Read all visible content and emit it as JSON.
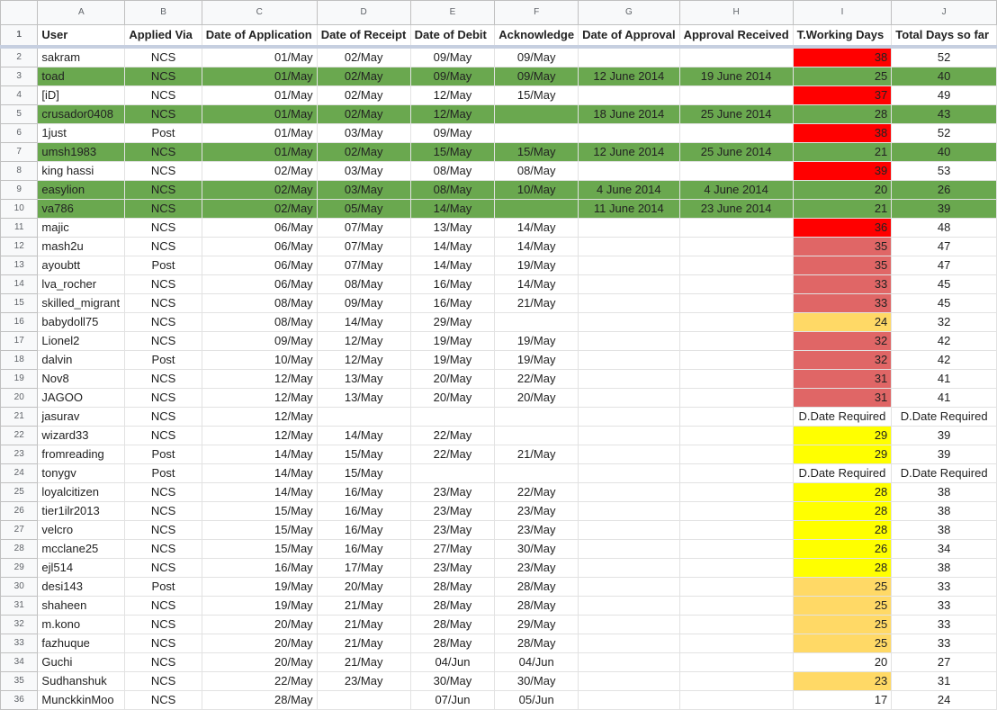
{
  "columns": [
    "A",
    "B",
    "C",
    "D",
    "E",
    "F",
    "G",
    "H",
    "I",
    "J"
  ],
  "headers": [
    "User",
    "Applied Via",
    "Date of Application",
    "Date of Receipt",
    "Date of Debit",
    "Acknowledge",
    "Date of Approval",
    "Approval Received",
    "T.Working Days",
    "Total Days so far"
  ],
  "colors": {
    "approved_row": "#6aa84f",
    "red": "#ff0000",
    "light_red": "#e06666",
    "orange": "#ffd966",
    "yellow": "#ffff00"
  },
  "rows": [
    {
      "n": "2",
      "c": [
        "sakram",
        "NCS",
        "01/May",
        "02/May",
        "09/May",
        "09/May",
        "",
        "",
        "38",
        "52"
      ],
      "g": false,
      "h": "bred"
    },
    {
      "n": "3",
      "c": [
        "toad",
        "NCS",
        "01/May",
        "02/May",
        "09/May",
        "09/May",
        "12 June 2014",
        "19 June 2014",
        "25",
        "40"
      ],
      "g": true,
      "h": ""
    },
    {
      "n": "4",
      "c": [
        "[iD]",
        "NCS",
        "01/May",
        "02/May",
        "12/May",
        "15/May",
        "",
        "",
        "37",
        "49"
      ],
      "g": false,
      "h": "bred"
    },
    {
      "n": "5",
      "c": [
        "crusador0408",
        "NCS",
        "01/May",
        "02/May",
        "12/May",
        "",
        "18 June 2014",
        "25 June 2014",
        "28",
        "43"
      ],
      "g": true,
      "h": ""
    },
    {
      "n": "6",
      "c": [
        "1just",
        "Post",
        "01/May",
        "03/May",
        "09/May",
        "",
        "",
        "",
        "38",
        "52"
      ],
      "g": false,
      "h": "bred"
    },
    {
      "n": "7",
      "c": [
        "umsh1983",
        "NCS",
        "01/May",
        "02/May",
        "15/May",
        "15/May",
        "12 June 2014",
        "25 June 2014",
        "21",
        "40"
      ],
      "g": true,
      "h": ""
    },
    {
      "n": "8",
      "c": [
        "king hassi",
        "NCS",
        "02/May",
        "03/May",
        "08/May",
        "08/May",
        "",
        "",
        "39",
        "53"
      ],
      "g": false,
      "h": "bred"
    },
    {
      "n": "9",
      "c": [
        "easylion",
        "NCS",
        "02/May",
        "03/May",
        "08/May",
        "10/May",
        "4 June 2014",
        "4 June 2014",
        "20",
        "26"
      ],
      "g": true,
      "h": ""
    },
    {
      "n": "10",
      "c": [
        "va786",
        "NCS",
        "02/May",
        "05/May",
        "14/May",
        "",
        "11 June 2014",
        "23 June 2014",
        "21",
        "39"
      ],
      "g": true,
      "h": ""
    },
    {
      "n": "11",
      "c": [
        "majic",
        "NCS",
        "06/May",
        "07/May",
        "13/May",
        "14/May",
        "",
        "",
        "36",
        "48"
      ],
      "g": false,
      "h": "bred"
    },
    {
      "n": "12",
      "c": [
        "mash2u",
        "NCS",
        "06/May",
        "07/May",
        "14/May",
        "14/May",
        "",
        "",
        "35",
        "47"
      ],
      "g": false,
      "h": "blred"
    },
    {
      "n": "13",
      "c": [
        "ayoubtt",
        "Post",
        "06/May",
        "07/May",
        "14/May",
        "19/May",
        "",
        "",
        "35",
        "47"
      ],
      "g": false,
      "h": "blred"
    },
    {
      "n": "14",
      "c": [
        "lva_rocher",
        "NCS",
        "06/May",
        "08/May",
        "16/May",
        "14/May",
        "",
        "",
        "33",
        "45"
      ],
      "g": false,
      "h": "blred"
    },
    {
      "n": "15",
      "c": [
        "skilled_migrant",
        "NCS",
        "08/May",
        "09/May",
        "16/May",
        "21/May",
        "",
        "",
        "33",
        "45"
      ],
      "g": false,
      "h": "blred"
    },
    {
      "n": "16",
      "c": [
        "babydoll75",
        "NCS",
        "08/May",
        "14/May",
        "29/May",
        "",
        "",
        "",
        "24",
        "32"
      ],
      "g": false,
      "h": "borange"
    },
    {
      "n": "17",
      "c": [
        "Lionel2",
        "NCS",
        "09/May",
        "12/May",
        "19/May",
        "19/May",
        "",
        "",
        "32",
        "42"
      ],
      "g": false,
      "h": "blred"
    },
    {
      "n": "18",
      "c": [
        "dalvin",
        "Post",
        "10/May",
        "12/May",
        "19/May",
        "19/May",
        "",
        "",
        "32",
        "42"
      ],
      "g": false,
      "h": "blred"
    },
    {
      "n": "19",
      "c": [
        "Nov8",
        "NCS",
        "12/May",
        "13/May",
        "20/May",
        "22/May",
        "",
        "",
        "31",
        "41"
      ],
      "g": false,
      "h": "blred"
    },
    {
      "n": "20",
      "c": [
        "JAGOO",
        "NCS",
        "12/May",
        "13/May",
        "20/May",
        "20/May",
        "",
        "",
        "31",
        "41"
      ],
      "g": false,
      "h": "blred"
    },
    {
      "n": "21",
      "c": [
        "jasurav",
        "NCS",
        "12/May",
        "",
        "",
        "",
        "",
        "",
        "D.Date Required",
        "D.Date Required"
      ],
      "g": false,
      "h": "",
      "t": true
    },
    {
      "n": "22",
      "c": [
        "wizard33",
        "NCS",
        "12/May",
        "14/May",
        "22/May",
        "",
        "",
        "",
        "29",
        "39"
      ],
      "g": false,
      "h": "byellow"
    },
    {
      "n": "23",
      "c": [
        "fromreading",
        "Post",
        "14/May",
        "15/May",
        "22/May",
        "21/May",
        "",
        "",
        "29",
        "39"
      ],
      "g": false,
      "h": "byellow"
    },
    {
      "n": "24",
      "c": [
        "tonygv",
        "Post",
        "14/May",
        "15/May",
        "",
        "",
        "",
        "",
        "D.Date Required",
        "D.Date Required"
      ],
      "g": false,
      "h": "",
      "t": true
    },
    {
      "n": "25",
      "c": [
        "loyalcitizen",
        "NCS",
        "14/May",
        "16/May",
        "23/May",
        "22/May",
        "",
        "",
        "28",
        "38"
      ],
      "g": false,
      "h": "byellow"
    },
    {
      "n": "26",
      "c": [
        "tier1ilr2013",
        "NCS",
        "15/May",
        "16/May",
        "23/May",
        "23/May",
        "",
        "",
        "28",
        "38"
      ],
      "g": false,
      "h": "byellow"
    },
    {
      "n": "27",
      "c": [
        "velcro",
        "NCS",
        "15/May",
        "16/May",
        "23/May",
        "23/May",
        "",
        "",
        "28",
        "38"
      ],
      "g": false,
      "h": "byellow"
    },
    {
      "n": "28",
      "c": [
        "mcclane25",
        "NCS",
        "15/May",
        "16/May",
        "27/May",
        "30/May",
        "",
        "",
        "26",
        "34"
      ],
      "g": false,
      "h": "byellow"
    },
    {
      "n": "29",
      "c": [
        "ejl514",
        "NCS",
        "16/May",
        "17/May",
        "23/May",
        "23/May",
        "",
        "",
        "28",
        "38"
      ],
      "g": false,
      "h": "byellow"
    },
    {
      "n": "30",
      "c": [
        "desi143",
        "Post",
        "19/May",
        "20/May",
        "28/May",
        "28/May",
        "",
        "",
        "25",
        "33"
      ],
      "g": false,
      "h": "borange"
    },
    {
      "n": "31",
      "c": [
        "shaheen",
        "NCS",
        "19/May",
        "21/May",
        "28/May",
        "28/May",
        "",
        "",
        "25",
        "33"
      ],
      "g": false,
      "h": "borange"
    },
    {
      "n": "32",
      "c": [
        "m.kono",
        "NCS",
        "20/May",
        "21/May",
        "28/May",
        "29/May",
        "",
        "",
        "25",
        "33"
      ],
      "g": false,
      "h": "borange"
    },
    {
      "n": "33",
      "c": [
        "fazhuque",
        "NCS",
        "20/May",
        "21/May",
        "28/May",
        "28/May",
        "",
        "",
        "25",
        "33"
      ],
      "g": false,
      "h": "borange"
    },
    {
      "n": "34",
      "c": [
        "Guchi",
        "NCS",
        "20/May",
        "21/May",
        "04/Jun",
        "04/Jun",
        "",
        "",
        "20",
        "27"
      ],
      "g": false,
      "h": ""
    },
    {
      "n": "35",
      "c": [
        "Sudhanshuk",
        "NCS",
        "22/May",
        "23/May",
        "30/May",
        "30/May",
        "",
        "",
        "23",
        "31"
      ],
      "g": false,
      "h": "borange"
    },
    {
      "n": "36",
      "c": [
        "MunckkinMoo",
        "NCS",
        "28/May",
        "",
        "07/Jun",
        "05/Jun",
        "",
        "",
        "17",
        "24"
      ],
      "g": false,
      "h": ""
    }
  ]
}
